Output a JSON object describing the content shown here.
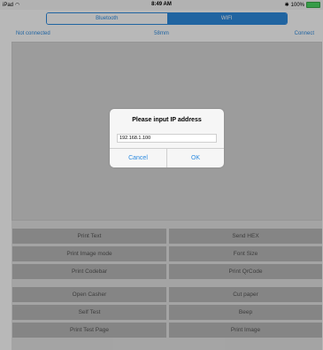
{
  "status_bar": {
    "device": "iPad",
    "time": "8:49 AM",
    "battery_percent": "100%",
    "battery_level": 1.0
  },
  "connection_segment": {
    "options": [
      "Bluetooth",
      "WIFI"
    ],
    "selected": "WIFI"
  },
  "info_bar": {
    "status": "Not connected",
    "paper_size": "58mm",
    "connect_label": "Connect"
  },
  "buttons": [
    {
      "label": "Print Text"
    },
    {
      "label": "Send HEX"
    },
    {
      "label": "Print Image mode"
    },
    {
      "label": "Font Size"
    },
    {
      "label": "Print Codebar"
    },
    {
      "label": "Print QrCode"
    },
    {
      "label": "Open Casher"
    },
    {
      "label": "Cut paper"
    },
    {
      "label": "Self Test"
    },
    {
      "label": "Beep"
    },
    {
      "label": "Print Test Page"
    },
    {
      "label": "Print Image"
    }
  ],
  "dialog": {
    "title": "Please input IP address",
    "ip_value": "192.168.1.100",
    "cancel_label": "Cancel",
    "ok_label": "OK"
  },
  "colors": {
    "accent": "#2d8be0",
    "button_bg": "#b9b9b9",
    "battery_green": "#4cd964"
  }
}
